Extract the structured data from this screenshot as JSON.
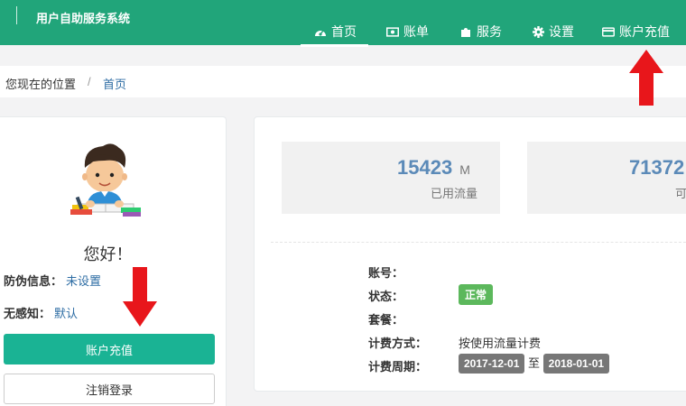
{
  "header": {
    "title": "用户自助服务系统",
    "nav": [
      {
        "label": "首页",
        "icon": "dashboard-icon",
        "active": true
      },
      {
        "label": "账单",
        "icon": "bill-icon"
      },
      {
        "label": "服务",
        "icon": "puzzle-icon"
      },
      {
        "label": "设置",
        "icon": "gear-icon"
      },
      {
        "label": "账户充值",
        "icon": "credit-card-icon"
      }
    ]
  },
  "breadcrumb": {
    "prefix": "您现在的位置",
    "separator": "/",
    "current": "首页"
  },
  "profile": {
    "greeting": "您好！",
    "anti_fake_label": "防伪信息：",
    "anti_fake_value": "未设置",
    "senseless_label": "无感知：",
    "senseless_value": "默认",
    "recharge_button": "账户充值",
    "logout_button": "注销登录"
  },
  "stats": {
    "used": {
      "value": "15423",
      "unit": "M",
      "label": "已用流量"
    },
    "available": {
      "value": "71372",
      "label": "可"
    }
  },
  "details": {
    "account_label": "账号：",
    "account_value": "",
    "status_label": "状态：",
    "status_value": "正常",
    "plan_label": "套餐：",
    "plan_value": "",
    "billing_method_label": "计费方式：",
    "billing_method_value": "按使用流量计费",
    "billing_period_label": "计费周期：",
    "period_start": "2017-12-01",
    "period_to": "至",
    "period_end": "2018-01-01"
  },
  "colors": {
    "header_bg": "#21a57a",
    "primary_button": "#1ab394",
    "stat_value": "#5b8ab8",
    "status_ok": "#5cb85c",
    "date_badge": "#777777",
    "arrow": "#e8161b"
  }
}
